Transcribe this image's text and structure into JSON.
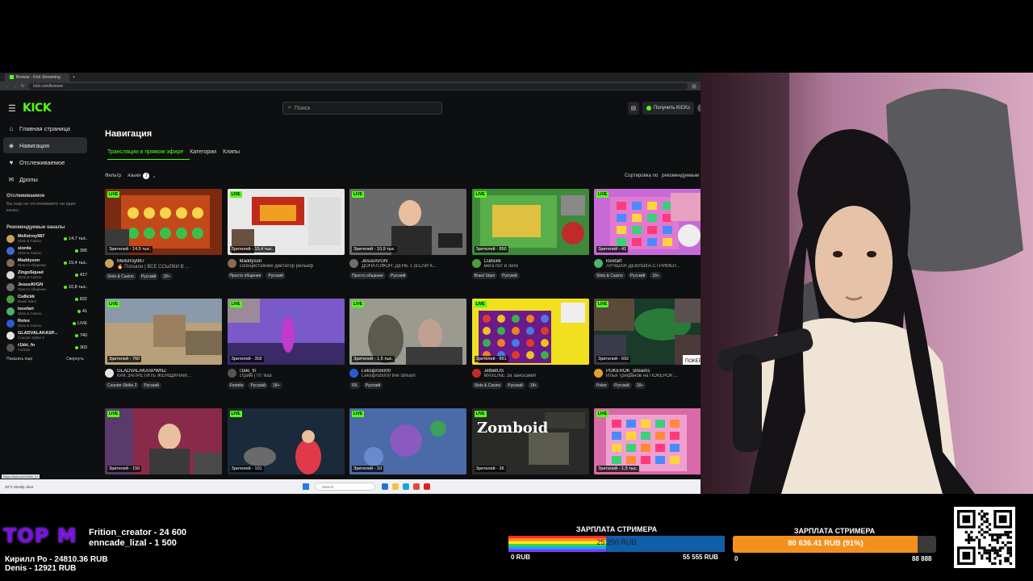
{
  "browser": {
    "tab_title": "Browse - Kick Streaming",
    "url": "kick.com/browse",
    "status_url": "https://kick.com/r1kki_fn"
  },
  "topnav": {
    "search_placeholder": "Поиск",
    "get_kicks": "Получить KICKs"
  },
  "sidebar": {
    "nav": [
      {
        "label": "Главная страница",
        "icon": "home-icon"
      },
      {
        "label": "Навигация",
        "icon": "compass-icon",
        "active": true
      },
      {
        "label": "Отслеживаемое",
        "icon": "heart-icon"
      },
      {
        "label": "Дропы",
        "icon": "gift-icon"
      }
    ],
    "following_title": "Отслеживаемое",
    "following_note": "Вы еще не отслеживаете ни один канал.",
    "recommended_title": "Рекомендуемые каналы",
    "channels": [
      {
        "name": "Mellstroy987",
        "category": "Slots & Casino",
        "viewers": "14,7 тыс.",
        "color": "#c9a15c"
      },
      {
        "name": "siorda",
        "category": "Slots & Casino",
        "viewers": "395",
        "color": "#3b6bd1"
      },
      {
        "name": "Maddyson",
        "category": "Просто общение",
        "viewers": "15,4 тыс.",
        "color": "#8a6a55"
      },
      {
        "name": "ZingoSquad",
        "category": "Slots & Casino",
        "viewers": "417",
        "color": "#d9d9d9"
      },
      {
        "name": "JesusAVGN",
        "category": "Просто общение",
        "viewers": "10,8 тыс.",
        "color": "#6d6d6d"
      },
      {
        "name": "Cu8ickk",
        "category": "Brawl Stars",
        "viewers": "832",
        "color": "#4a9e3e"
      },
      {
        "name": "lovefart",
        "category": "Slots & Casino",
        "viewers": "41",
        "color": "#4bb36a"
      },
      {
        "name": "Rolex",
        "category": "Slots & Casino",
        "viewers": "LIVE",
        "color": "#2a5bd7"
      },
      {
        "name": "GLADVALAKASP...",
        "category": "Counter-Strike 2",
        "viewers": "740",
        "color": "#e5e5e5"
      },
      {
        "name": "r1kki_fn",
        "category": "Fortnite",
        "viewers": "303",
        "color": "#555"
      }
    ],
    "show_more": "Показать еще",
    "collapse": "Свернуть"
  },
  "main": {
    "title": "Навигация",
    "tabs": [
      "Трансляции в прямом эфире",
      "Категории",
      "Клипы"
    ],
    "filter_label": "Фильтр",
    "languages_label": "языки",
    "languages_count": "1",
    "sort_label": "Сортировка по",
    "sort_value": "рекомендуемым"
  },
  "live_label": "LIVE",
  "cards": [
    {
      "viewers": "Зрителей - 14,5 тыс.",
      "channel": "Mellstroy987",
      "title": "🔥 Погнали | ВСЕ ССЫЛКИ В ...",
      "tags": [
        "Slots & Casino",
        "Русский",
        "18+"
      ],
      "thumb": "#7a2a10",
      "av": "#c9a15c"
    },
    {
      "viewers": "Зрителей - 15,4 тыс.",
      "channel": "Maddyson",
      "title": "солнцестояние диктатор рельеф",
      "tags": [
        "Просто общение",
        "Русский"
      ],
      "thumb": "#e8e8e8",
      "av": "#8a6a55"
    },
    {
      "viewers": "Зрителей - 10,9 тыс.",
      "channel": "JesusAVGN",
      "title": "ДОНАТОФОН: ДЕНЬ 1 (ЕСЛИ К...",
      "tags": [
        "Просто общение",
        "Русский"
      ],
      "thumb": "#5a5a5a",
      "av": "#6d6d6d"
    },
    {
      "viewers": "Зрителей - 850",
      "channel": "Cu8ickk",
      "title": "мега пот в лиге",
      "tags": [
        "Brawl Stars",
        "Русский"
      ],
      "thumb": "#3f8a3a",
      "av": "#4a9e3e"
    },
    {
      "viewers": "Зрителей - 41",
      "channel": "lovefart",
      "title": "ЛУЧШАЯ ДЕВУШКА-СТРИМЕР...",
      "tags": [
        "Slots & Casino",
        "Русский",
        "18+"
      ],
      "thumb": "#c76ad8",
      "av": "#4bb36a"
    },
    {
      "viewers": "Зрителей - 760",
      "channel": "GLADVALAKASPWNZ",
      "title": "КАК ЗАПРЕТИТЬ ЖЕНЩИНАМ...",
      "tags": [
        "Counter-Strike 2",
        "Русский"
      ],
      "thumb": "#a08a6a",
      "av": "#e5e5e5"
    },
    {
      "viewers": "Зрителей - 302",
      "channel": "r1kki_fn",
      "title": "стрим | !тг !каз",
      "tags": [
        "Fortnite",
        "Русский",
        "18+"
      ],
      "thumb": "#6a4aa8",
      "av": "#555"
    },
    {
      "viewers": "Зрителей - 1,5 тыс.",
      "channel": "Leksipro5000",
      "title": "Leksipro5000 live stream",
      "tags": [
        "IRL",
        "Русский"
      ],
      "thumb": "#8a8a80",
      "av": "#2a5bd7"
    },
    {
      "viewers": "Зрителей - 661",
      "channel": "JetbetUS",
      "title": "MAXLINE За заносами!",
      "tags": [
        "Slots & Casino",
        "Русский",
        "18+"
      ],
      "thumb": "#d4c41a",
      "av": "#c02a2a"
    },
    {
      "viewers": "Зрителей - 692",
      "channel": "POKEROK_streams",
      "title": "Илья Трифанов на ПОКЕРОК ...",
      "tags": [
        "Poker",
        "Русский",
        "18+"
      ],
      "thumb": "#1c4a2a",
      "av": "#e0a030"
    },
    {
      "viewers": "Зрителей - 150",
      "channel": "",
      "title": "",
      "tags": [],
      "thumb": "#7a3a5a",
      "av": "#555"
    },
    {
      "viewers": "Зрителей - 101",
      "channel": "",
      "title": "",
      "tags": [],
      "thumb": "#1a2a3a",
      "av": "#555"
    },
    {
      "viewers": "Зрителей - 10",
      "channel": "",
      "title": "",
      "tags": [],
      "thumb": "#4a6aa8",
      "av": "#555"
    },
    {
      "viewers": "Зрителей - 36",
      "channel": "",
      "title": "",
      "tags": [],
      "thumb": "#2a2a2a",
      "av": "#555"
    },
    {
      "viewers": "Зрителей - 1,5 тыс.",
      "channel": "",
      "title": "",
      "tags": [],
      "thumb": "#d86aa8",
      "av": "#555"
    }
  ],
  "thumb_texts": {
    "zomboid": "Zomboid",
    "poker_badge": "ПОКЕРОК"
  },
  "taskbar": {
    "weather": "29°C Mostly clear",
    "search": "Search"
  },
  "overlay": {
    "top_label": "TOP M",
    "donors": [
      "Frition_creator - 24 600",
      "enncade_lizal - 1 500"
    ],
    "donors2": [
      "Кирилл Ро - 24810.36 RUB",
      "Denis - 12921 RUB"
    ],
    "salary1": {
      "title": "ЗАРПЛАТА СТРИМЕРА",
      "value": "25 250 RUB",
      "min": "0 RUB",
      "max": "55 555 RUB",
      "fraction": 0.45
    },
    "salary2": {
      "title": "ЗАРПЛАТА СТРИМЕРА",
      "value": "80 636.41 RUB (91%)",
      "min": "0",
      "max": "88 888",
      "fraction": 0.91
    }
  },
  "colors": {
    "accent": "#53fc18",
    "bg": "#0e0f10",
    "overlay_orange": "#f4901e",
    "overlay_purple": "#7a12e0"
  }
}
